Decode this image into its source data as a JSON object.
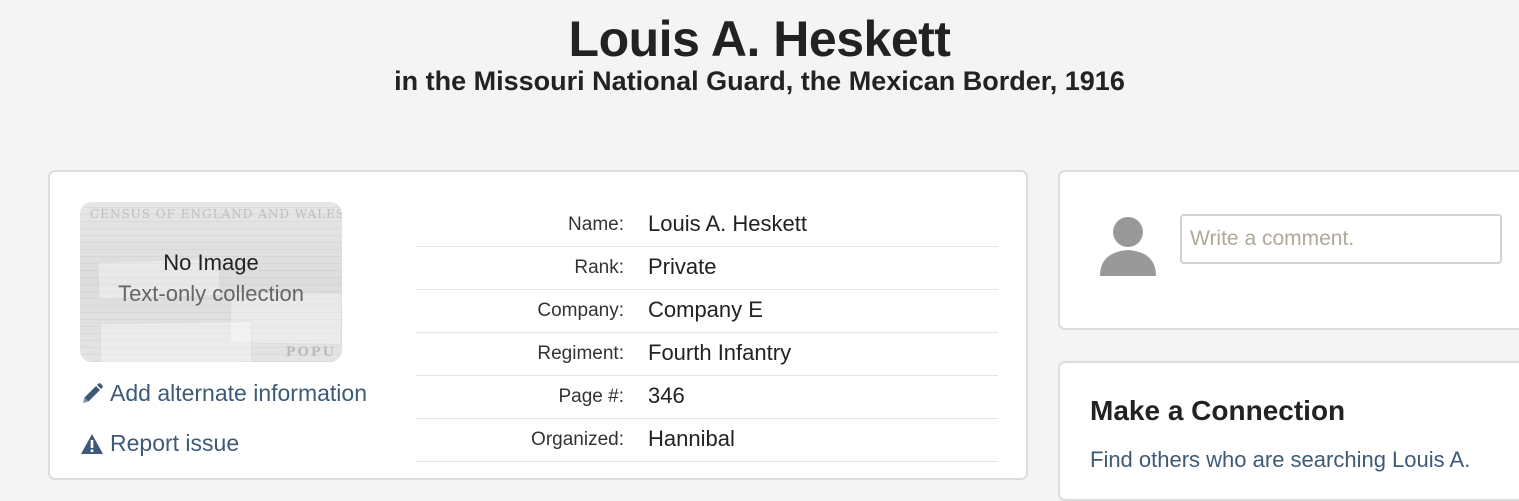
{
  "header": {
    "title": "Louis A. Heskett",
    "subtitle": "in the Missouri National Guard, the Mexican Border, 1916"
  },
  "thumbnail": {
    "census_text": "CENSUS OF ENGLAND AND WALES.",
    "popu_text": "POPU",
    "no_image": "No Image",
    "text_only": "Text-only collection"
  },
  "actions": {
    "add_alternate": "Add alternate information",
    "report_issue": "Report issue",
    "add_icon": "pencil-icon",
    "report_icon": "warning-icon"
  },
  "fields": [
    {
      "label": "Name:",
      "value": "Louis A. Heskett"
    },
    {
      "label": "Rank:",
      "value": "Private"
    },
    {
      "label": "Company:",
      "value": "Company E"
    },
    {
      "label": "Regiment:",
      "value": "Fourth Infantry"
    },
    {
      "label": "Page #:",
      "value": "346"
    },
    {
      "label": "Organized:",
      "value": "Hannibal"
    }
  ],
  "comment": {
    "placeholder": "Write a comment.",
    "avatar_icon": "user-avatar-icon"
  },
  "connection": {
    "title": "Make a Connection",
    "text": "Find others who are searching Louis A."
  },
  "colors": {
    "background": "#f4f4f4",
    "link": "#3d5a78",
    "card_border": "#dcdcdc"
  }
}
